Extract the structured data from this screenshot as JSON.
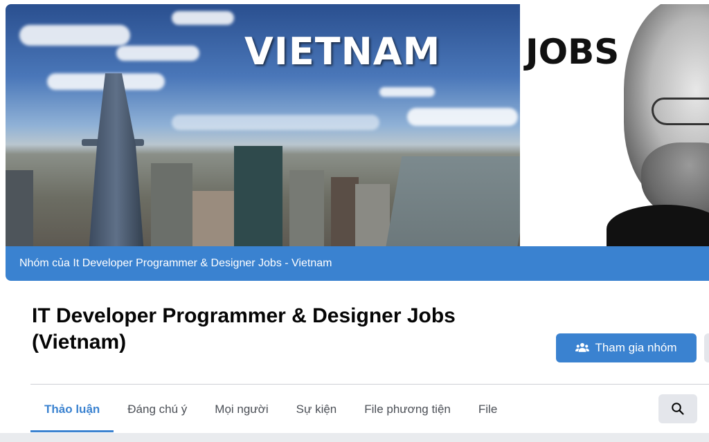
{
  "cover": {
    "title_part1": "VIETNAM",
    "title_part2": "JOBS"
  },
  "group": {
    "owner_strip": "Nhóm của It Developer Programmer & Designer Jobs - Vietnam",
    "title": "IT Developer Programmer & Designer Jobs (Vietnam)",
    "join_label": "Tham gia nhóm",
    "join_icon": "group-people-icon"
  },
  "tabs": [
    {
      "label": "Thảo luận",
      "active": true
    },
    {
      "label": "Đáng chú ý",
      "active": false
    },
    {
      "label": "Mọi người",
      "active": false
    },
    {
      "label": "Sự kiện",
      "active": false
    },
    {
      "label": "File phương tiện",
      "active": false
    },
    {
      "label": "File",
      "active": false
    }
  ],
  "search": {
    "icon": "search-icon"
  },
  "colors": {
    "accent": "#3a82d0",
    "button_gray": "#e4e6eb",
    "text_primary": "#050505",
    "text_secondary": "#4b4f56"
  }
}
